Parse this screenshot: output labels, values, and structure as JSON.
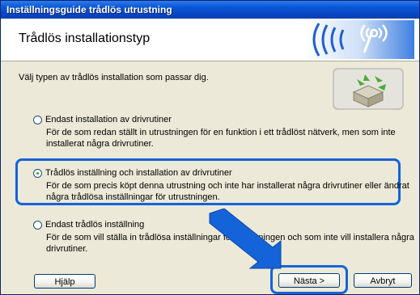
{
  "window": {
    "title": "Inställningsguide trådlös utrustning"
  },
  "header": {
    "heading": "Trådlös installationstyp",
    "logo_icon": "wireless-signal-icon"
  },
  "intro": "Välj typen av trådlös installation som passar dig.",
  "options": [
    {
      "label": "Endast installation av drivrutiner",
      "description": "För de som redan ställt in utrustningen för en funktion i ett trådlöst nätverk, men som inte installerat några drivrutiner.",
      "selected": false
    },
    {
      "label": "Trådlös inställning och installation av drivrutiner",
      "description": "För de som precis köpt denna utrustning och inte har installerat några drivrutiner eller ändrat några trådlösa inställningar för utrustningen.",
      "selected": true
    },
    {
      "label": "Endast trådlös inställning",
      "description": "För de som vill ställa in trådlösa inställningar för utrustningen och som inte vill installera några drivrutiner.",
      "selected": false
    }
  ],
  "buttons": {
    "help": "Hjälp",
    "next": "Nästa >",
    "cancel": "Avbryt"
  },
  "colors": {
    "titlebar": "#0b58d6",
    "highlight": "#1463d9",
    "face": "#ece9d8"
  }
}
